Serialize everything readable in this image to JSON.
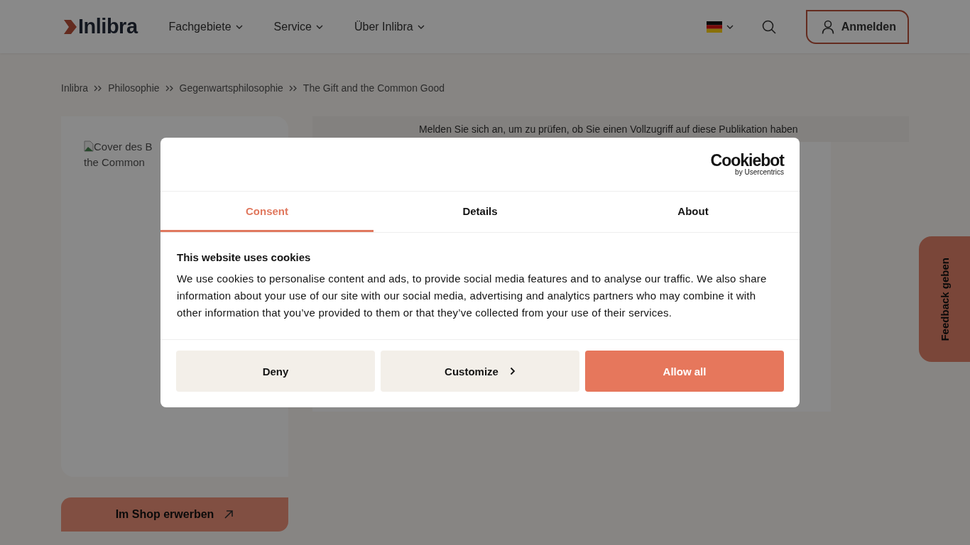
{
  "header": {
    "logo": "Inlibra",
    "nav": [
      {
        "label": "Fachgebiete"
      },
      {
        "label": "Service"
      },
      {
        "label": "Über Inlibra"
      }
    ],
    "login": "Anmelden"
  },
  "breadcrumb": [
    "Inlibra",
    "Philosophie",
    "Gegenwartsphilosophie",
    "The Gift and the Common Good"
  ],
  "cover_alt_lines": [
    "Cover des B",
    "the Common"
  ],
  "shop_button": "Im Shop erwerben",
  "access_notice": "Melden Sie sich an, um zu prüfen, ob Sie einen Vollzugriff auf diese Publikation haben",
  "feedback_tab": "Feedback geben",
  "cookie_dialog": {
    "brand": "Cookiebot",
    "brand_sub": "by Usercentrics",
    "tabs": [
      {
        "label": "Consent",
        "selected": true
      },
      {
        "label": "Details",
        "selected": false
      },
      {
        "label": "About",
        "selected": false
      }
    ],
    "title": "This website uses cookies",
    "text": "We use cookies to personalise content and ads, to provide social media features and to analyse our traffic. We also share information about your use of our site with our social media, advertising and analytics partners who may combine it with other information that you’ve provided to them or that they’ve collected from your use of their services.",
    "buttons": [
      {
        "label": "Deny",
        "kind": "secondary"
      },
      {
        "label": "Customize",
        "kind": "more"
      },
      {
        "label": "Allow all",
        "kind": "primary"
      }
    ]
  }
}
